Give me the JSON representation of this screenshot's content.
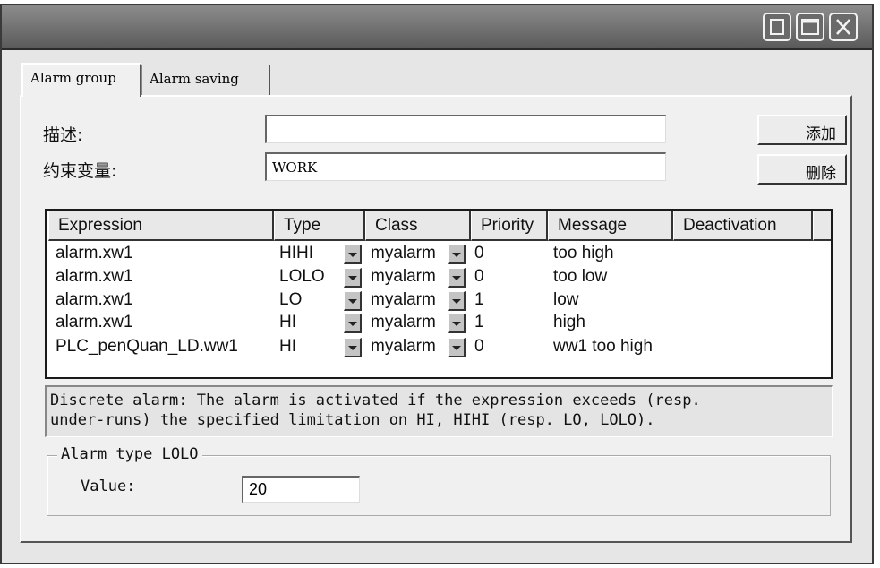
{
  "window": {
    "controls": {
      "minimize_icon": "minimize-icon",
      "maximize_icon": "maximize-icon",
      "close_icon": "close-icon"
    }
  },
  "tabs": [
    {
      "label": "Alarm group",
      "active": true
    },
    {
      "label": "Alarm saving",
      "active": false
    }
  ],
  "form": {
    "description_label": "描述:",
    "description_value": "",
    "constraint_label": "约束变量:",
    "constraint_value": "WORK"
  },
  "buttons": {
    "add_label": "添加",
    "delete_label": "删除"
  },
  "table": {
    "columns": [
      "Expression",
      "Type",
      "Class",
      "Priority",
      "Message",
      "Deactivation"
    ],
    "rows": [
      {
        "expression": "alarm.xw1",
        "type": "HIHI",
        "class": "myalarm",
        "priority": "0",
        "message": "too high",
        "deactivation": ""
      },
      {
        "expression": "alarm.xw1",
        "type": "LOLO",
        "class": "myalarm",
        "priority": "0",
        "message": "too low",
        "deactivation": ""
      },
      {
        "expression": "alarm.xw1",
        "type": "LO",
        "class": "myalarm",
        "priority": "1",
        "message": "low",
        "deactivation": ""
      },
      {
        "expression": "alarm.xw1",
        "type": "HI",
        "class": "myalarm",
        "priority": "1",
        "message": "high",
        "deactivation": ""
      },
      {
        "expression": "PLC_penQuan_LD.ww1",
        "type": "HI",
        "class": "myalarm",
        "priority": "0",
        "message": "ww1 too high",
        "deactivation": ""
      }
    ]
  },
  "info": {
    "line1": "Discrete alarm: The alarm is activated if the expression exceeds (resp.",
    "line2": "under-runs) the specified limitation on HI, HIHI (resp. LO, LOLO)."
  },
  "alarm_type": {
    "title": "Alarm type LOLO",
    "value_label": "Value:",
    "value": "20"
  }
}
